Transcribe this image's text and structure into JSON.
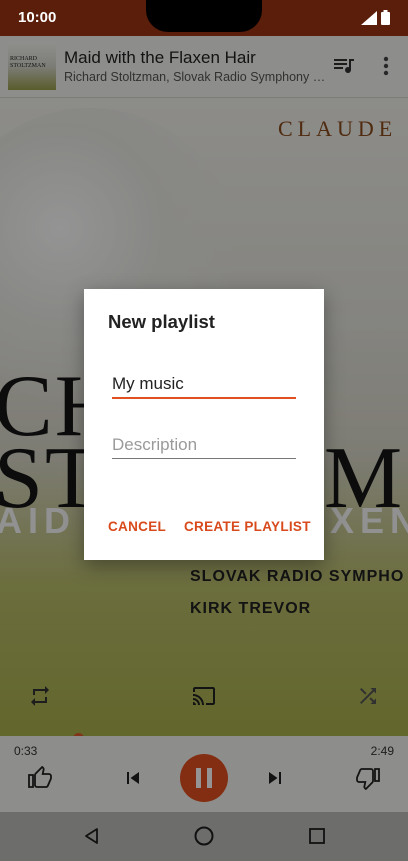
{
  "status_bar": {
    "time": "10:00"
  },
  "now_playing": {
    "title": "Maid with the Flaxen Hair",
    "artist": "Richard Stoltzman, Slovak Radio Symphony Orc...",
    "thumb_text": "RICHARD STOLTZMAN"
  },
  "album_art": {
    "top_text": "CLAUDE",
    "big_line_1": "CHE",
    "big_line_2": "STOLTZM",
    "maid_left": "AID",
    "maid_right": "XEN",
    "line_orchestra": "SLOVAK RADIO SYMPHO",
    "line_conductor": "KIRK TREVOR"
  },
  "player": {
    "elapsed": "0:33",
    "total": "2:49",
    "progress_fraction": 0.19
  },
  "dialog": {
    "title": "New playlist",
    "name_value": "My music",
    "description_placeholder": "Description",
    "cancel_label": "CANCEL",
    "create_label": "CREATE PLAYLIST"
  },
  "colors": {
    "accent": "#e2501f",
    "status_bar": "#5a1e0b",
    "nav_bar": "#6d6d6b"
  },
  "icons": {
    "queue": "queue-music-icon",
    "more": "more-vert-icon",
    "repeat": "repeat-icon",
    "cast": "cast-icon",
    "shuffle": "shuffle-icon",
    "like": "thumb-up-icon",
    "prev": "skip-previous-icon",
    "pause": "pause-icon",
    "next": "skip-next-icon",
    "dislike": "thumb-down-icon"
  }
}
